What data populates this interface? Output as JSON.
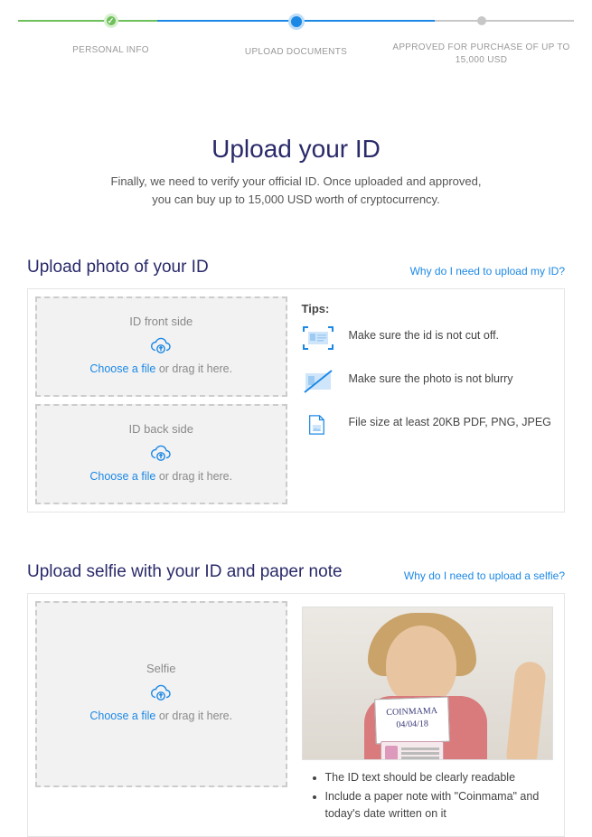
{
  "progress": {
    "steps": [
      {
        "label": "PERSONAL INFO"
      },
      {
        "label": "UPLOAD DOCUMENTS"
      },
      {
        "label": "APPROVED FOR PURCHASE OF UP TO 15,000 USD"
      }
    ]
  },
  "header": {
    "title": "Upload your ID",
    "subtitle_line1": "Finally, we need to verify your official ID. Once uploaded and approved,",
    "subtitle_line2": "you can buy up to 15,000 USD worth of cryptocurrency."
  },
  "id_section": {
    "title": "Upload photo of your ID",
    "help_link": "Why do I need to upload my ID?",
    "front": {
      "label": "ID front side",
      "choose": "Choose a file",
      "drag": " or drag it here."
    },
    "back": {
      "label": "ID back side",
      "choose": "Choose a file",
      "drag": " or drag it here."
    },
    "tips_title": "Tips:",
    "tips": [
      "Make sure the id is not cut off.",
      "Make sure the photo is not blurry",
      "File size at least 20KB PDF, PNG, JPEG"
    ]
  },
  "selfie_section": {
    "title": "Upload selfie with your ID and paper note",
    "help_link": "Why do I need to upload a selfie?",
    "dropzone": {
      "label": "Selfie",
      "choose": "Choose a file",
      "drag": " or drag it here."
    },
    "note_text_line1": "COINMAMA",
    "note_text_line2": "04/04/18",
    "bullets": [
      "The ID text should be clearly readable",
      "Include a paper note with \"Coinmama\" and today's date written on it"
    ]
  }
}
